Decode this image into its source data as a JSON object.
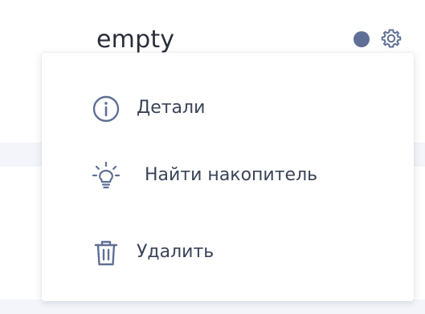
{
  "device": {
    "name": "empty",
    "status_color": "#5f6f95",
    "settings_icon": "gear-icon"
  },
  "context_menu": {
    "items": [
      {
        "label": "Детали",
        "icon": "info-icon"
      },
      {
        "label": "Найти накопитель",
        "icon": "lightbulb-icon"
      },
      {
        "label": "Удалить",
        "icon": "trash-icon"
      }
    ]
  },
  "colors": {
    "text": "#3a4358",
    "icon": "#5f6f95",
    "menu_background": "#ffffff"
  }
}
